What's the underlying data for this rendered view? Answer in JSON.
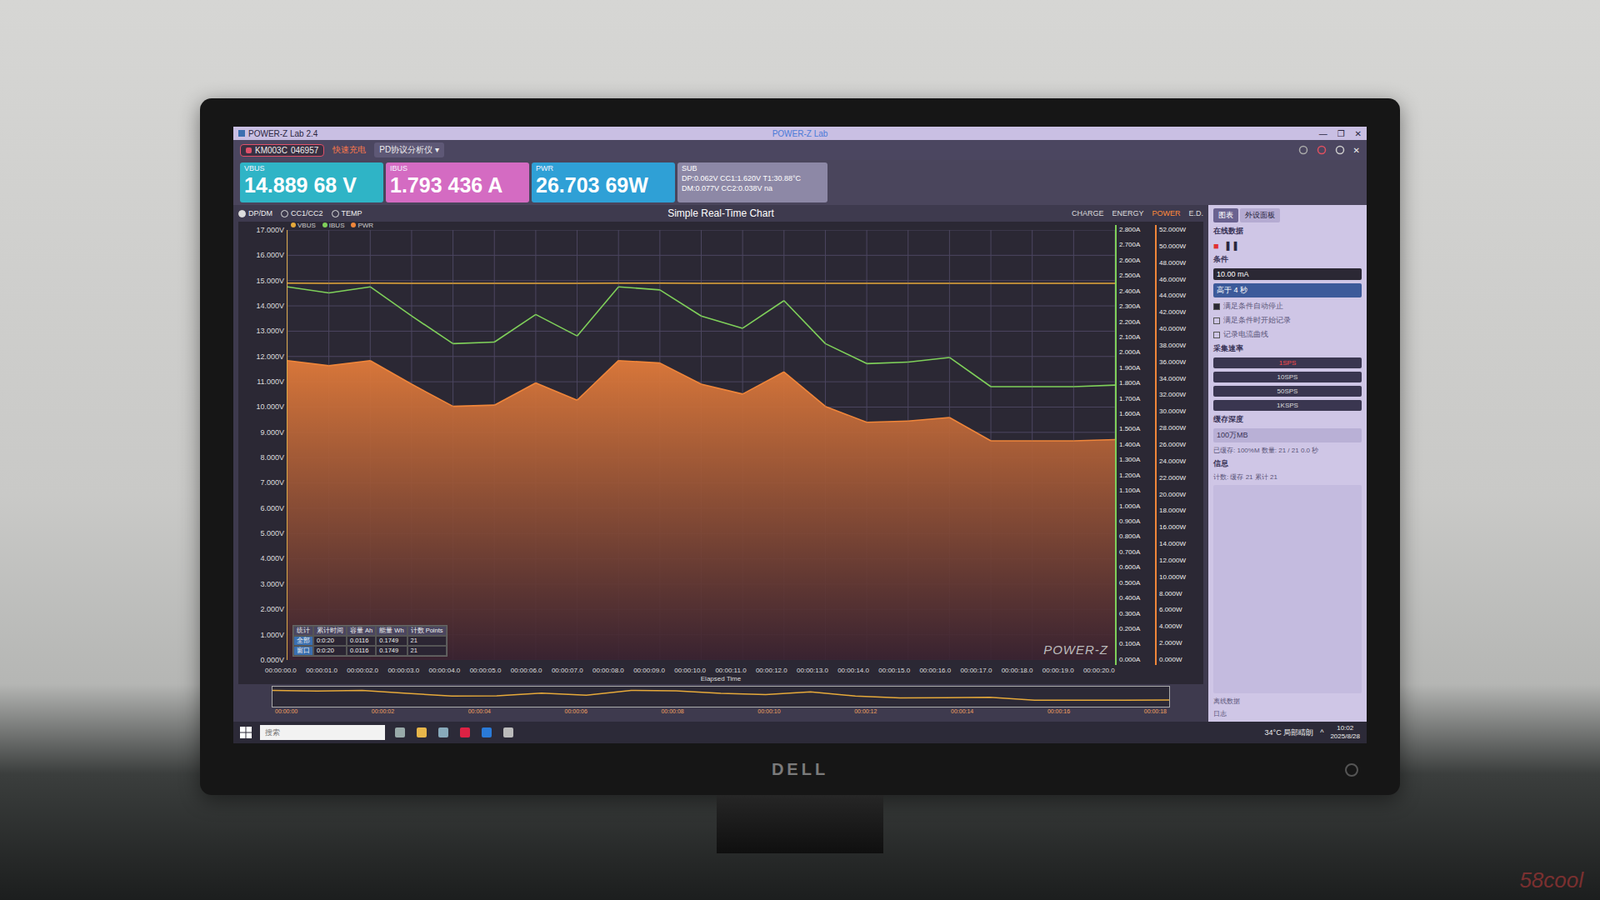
{
  "window": {
    "title": "POWER-Z Lab 2.4",
    "center_title": "POWER-Z Lab",
    "controls": [
      "—",
      "❐",
      "✕"
    ]
  },
  "toolbar": {
    "device": "KM003C",
    "serial": "046957",
    "mode": "快速充电",
    "menu": "PD协议分析仪 ▾",
    "close": "✕"
  },
  "readouts": [
    {
      "label": "VBUS",
      "value": "14.889 68 V",
      "color": "#2fb4c6"
    },
    {
      "label": "IBUS",
      "value": "1.793 436 A",
      "color": "#d46bc2"
    },
    {
      "label": "PWR",
      "value": "26.703 69W",
      "color": "#2fa0d6"
    }
  ],
  "sub": {
    "label": "SUB",
    "lines": [
      "DP:0.062V  CC1:1.620V  T1:30.88°C",
      "DM:0.077V  CC2:0.038V  na"
    ]
  },
  "chart": {
    "tabs": [
      {
        "label": "DP/DM",
        "selected": true
      },
      {
        "label": "CC1/CC2",
        "selected": false
      },
      {
        "label": "TEMP",
        "selected": false
      }
    ],
    "title": "Simple Real-Time Chart",
    "views": [
      {
        "label": "CHARGE",
        "selected": false
      },
      {
        "label": "ENERGY",
        "selected": false
      },
      {
        "label": "POWER",
        "selected": true
      },
      {
        "label": "E.D.",
        "selected": false
      }
    ],
    "series": [
      {
        "name": "VBUS",
        "color": "#e6a93a",
        "max": 17,
        "values": [
          14.9,
          14.89,
          14.9,
          14.89,
          14.89,
          14.89,
          14.89,
          14.89,
          14.9,
          14.9,
          14.89,
          14.89,
          14.89,
          14.89,
          14.89,
          14.89,
          14.89,
          14.89,
          14.89,
          14.89,
          14.89
        ]
      },
      {
        "name": "IBUS",
        "color": "#7fd05a",
        "max": 2.8,
        "values": [
          2.43,
          2.39,
          2.43,
          2.24,
          2.06,
          2.07,
          2.25,
          2.11,
          2.43,
          2.41,
          2.24,
          2.16,
          2.34,
          2.06,
          1.93,
          1.94,
          1.97,
          1.78,
          1.78,
          1.78,
          1.79
        ]
      },
      {
        "name": "PWR",
        "color": "#f0863a",
        "max": 52,
        "values": [
          36.21,
          35.59,
          36.21,
          33.35,
          30.67,
          30.82,
          33.5,
          31.42,
          36.21,
          35.91,
          33.35,
          32.16,
          34.84,
          30.67,
          28.74,
          28.89,
          29.33,
          26.5,
          26.5,
          26.5,
          26.65
        ]
      }
    ],
    "v_ticks": [
      "17.000V",
      "16.000V",
      "15.000V",
      "14.000V",
      "13.000V",
      "12.000V",
      "11.000V",
      "10.000V",
      "9.000V",
      "8.000V",
      "7.000V",
      "6.000V",
      "5.000V",
      "4.000V",
      "3.000V",
      "2.000V",
      "1.000V",
      "0.000V"
    ],
    "a_ticks": [
      "2.800A",
      "2.700A",
      "2.600A",
      "2.500A",
      "2.400A",
      "2.300A",
      "2.200A",
      "2.100A",
      "2.000A",
      "1.900A",
      "1.800A",
      "1.700A",
      "1.600A",
      "1.500A",
      "1.400A",
      "1.300A",
      "1.200A",
      "1.100A",
      "1.000A",
      "0.900A",
      "0.800A",
      "0.700A",
      "0.600A",
      "0.500A",
      "0.400A",
      "0.300A",
      "0.200A",
      "0.100A",
      "0.000A"
    ],
    "w_ticks": [
      "52.000W",
      "50.000W",
      "48.000W",
      "46.000W",
      "44.000W",
      "42.000W",
      "40.000W",
      "38.000W",
      "36.000W",
      "34.000W",
      "32.000W",
      "30.000W",
      "28.000W",
      "26.000W",
      "24.000W",
      "22.000W",
      "20.000W",
      "18.000W",
      "16.000W",
      "14.000W",
      "12.000W",
      "10.000W",
      "8.000W",
      "6.000W",
      "4.000W",
      "2.000W",
      "0.000W"
    ],
    "x_ticks": [
      "00:00:00.0",
      "00:00:01.0",
      "00:00:02.0",
      "00:00:03.0",
      "00:00:04.0",
      "00:00:05.0",
      "00:00:06.0",
      "00:00:07.0",
      "00:00:08.0",
      "00:00:09.0",
      "00:00:10.0",
      "00:00:11.0",
      "00:00:12.0",
      "00:00:13.0",
      "00:00:14.0",
      "00:00:15.0",
      "00:00:16.0",
      "00:00:17.0",
      "00:00:18.0",
      "00:00:19.0",
      "00:00:20.0"
    ],
    "x_title": "Elapsed Time",
    "logo": "POWER-Z",
    "stats": {
      "columns": [
        "统计",
        "累计时间",
        "容量 Ah",
        "能量 Wh",
        "计数 Points"
      ],
      "rows": [
        [
          "全部",
          "0:0:20",
          "0.0116",
          "0.1749",
          "21"
        ],
        [
          "窗口",
          "0:0:20",
          "0.0116",
          "0.1749",
          "21"
        ]
      ]
    },
    "minimap_ticks": [
      "00:00:00",
      "00:00:02",
      "00:00:04",
      "00:00:06",
      "00:00:08",
      "00:00:10",
      "00:00:12",
      "00:00:14",
      "00:00:16",
      "00:00:18"
    ]
  },
  "right_panel": {
    "tabs": [
      {
        "label": "图表",
        "selected": true
      },
      {
        "label": "外设面板",
        "selected": false
      }
    ],
    "section": "在线数据",
    "record": "■",
    "pause": "❚❚",
    "condition_label": "条件",
    "fields": [
      {
        "value": "10.00 mA",
        "selected": false
      },
      {
        "value": "高于 4 秒",
        "selected": true
      }
    ],
    "checkboxes": [
      {
        "label": "满足条件自动停止",
        "checked": true
      },
      {
        "label": "满足条件时开始记录",
        "checked": false
      },
      {
        "label": "记录电流曲线",
        "checked": false
      }
    ],
    "rate_label": "采集速率",
    "rates": [
      {
        "label": "1SPS",
        "selected": true
      },
      {
        "label": "10SPS",
        "selected": false
      },
      {
        "label": "50SPS",
        "selected": false
      },
      {
        "label": "1KSPS",
        "selected": false
      }
    ],
    "buffer_label": "缓存深度",
    "buffer_value": "100万MB",
    "buffer_note": "已缓存: 100%M 数量: 21 / 21 0.0 秒",
    "info_label": "信息",
    "info": "计数: 缓存 21 累计 21",
    "bottom": [
      "离线数据",
      "日志"
    ]
  },
  "taskbar": {
    "search": "搜索",
    "weather": "34°C 局部晴朗",
    "tray": "^",
    "time": "10:02",
    "date": "2025/8/28"
  },
  "bezel": {
    "brand": "DELL"
  },
  "watermark": "58cool"
}
